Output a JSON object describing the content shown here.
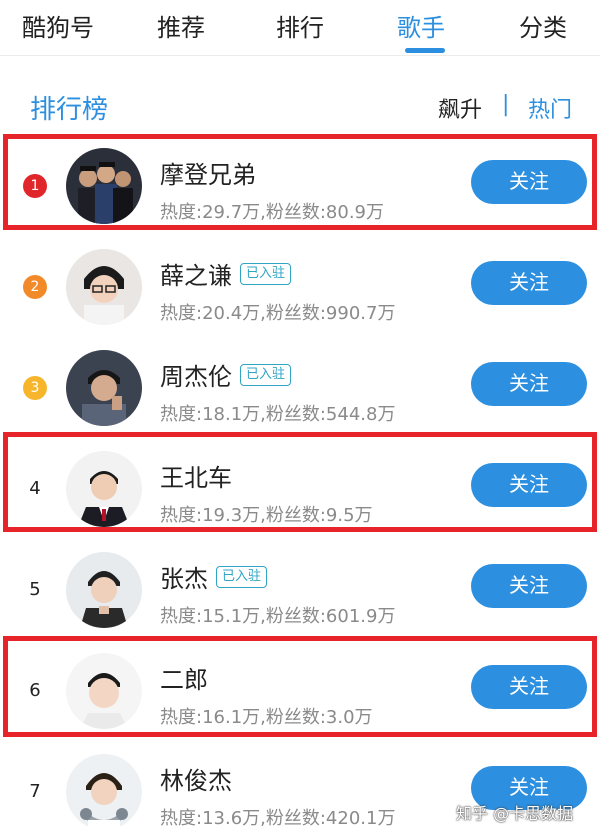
{
  "nav": {
    "tabs": [
      "酷狗号",
      "推荐",
      "排行",
      "歌手",
      "分类"
    ],
    "active_tab": "歌手"
  },
  "section": {
    "title": "排行榜",
    "sort_rise": "飙升",
    "sort_sep": "|",
    "sort_hot": "热门"
  },
  "follow_label": "关注",
  "verified_label": "已入驻",
  "colors": {
    "accent": "#2d8fdf",
    "highlight_border": "#e8242b",
    "rank1_badge": "#e0262b",
    "rank2_badge": "#f38a2a",
    "rank3_badge": "#f7b52c"
  },
  "artists": [
    {
      "rank": "1",
      "name": "摩登兄弟",
      "verified": false,
      "stats": "热度:29.7万,粉丝数:80.9万"
    },
    {
      "rank": "2",
      "name": "薛之谦",
      "verified": true,
      "stats": "热度:20.4万,粉丝数:990.7万"
    },
    {
      "rank": "3",
      "name": "周杰伦",
      "verified": true,
      "stats": "热度:18.1万,粉丝数:544.8万"
    },
    {
      "rank": "4",
      "name": "王北车",
      "verified": false,
      "stats": "热度:19.3万,粉丝数:9.5万"
    },
    {
      "rank": "5",
      "name": "张杰",
      "verified": true,
      "stats": "热度:15.1万,粉丝数:601.9万"
    },
    {
      "rank": "6",
      "name": "二郎",
      "verified": false,
      "stats": "热度:16.1万,粉丝数:3.0万"
    },
    {
      "rank": "7",
      "name": "林俊杰",
      "verified": false,
      "stats": "热度:13.6万,粉丝数:420.1万"
    }
  ],
  "watermark": "知乎 @卡思数据"
}
